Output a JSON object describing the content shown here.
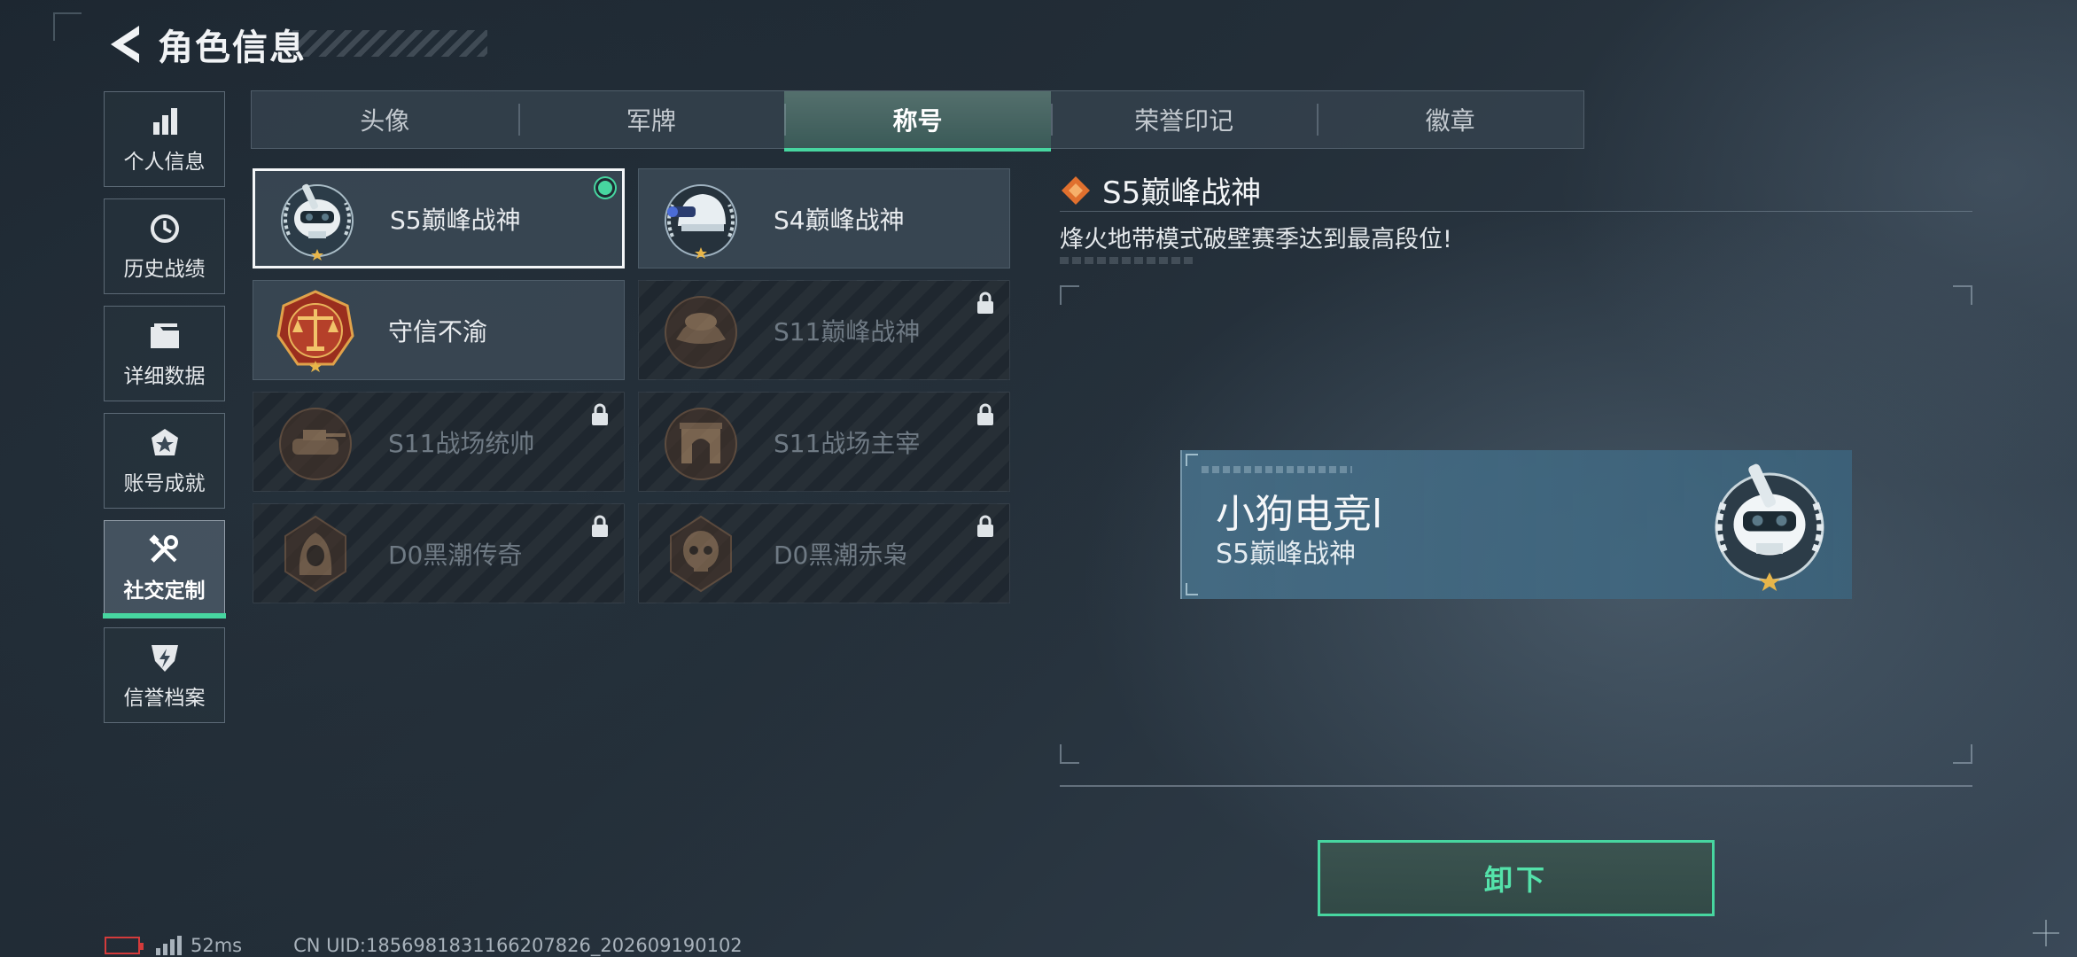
{
  "header": {
    "title": "角色信息"
  },
  "sidebar": {
    "items": [
      {
        "label": "个人信息",
        "icon": "bar-chart-icon"
      },
      {
        "label": "历史战绩",
        "icon": "clock-history-icon"
      },
      {
        "label": "详细数据",
        "icon": "folder-icon"
      },
      {
        "label": "账号成就",
        "icon": "achievement-icon"
      },
      {
        "label": "社交定制",
        "icon": "tools-icon",
        "active": true
      },
      {
        "label": "信誉档案",
        "icon": "credit-badge-icon"
      }
    ]
  },
  "tabs": [
    {
      "label": "头像"
    },
    {
      "label": "军牌"
    },
    {
      "label": "称号",
      "active": true
    },
    {
      "label": "荣誉印记"
    },
    {
      "label": "徽章"
    }
  ],
  "titles": [
    {
      "name": "S5巅峰战神",
      "emblem": "diver-skull-emblem",
      "selected": true,
      "equipped": true,
      "locked": false
    },
    {
      "name": "S4巅峰战神",
      "emblem": "helmet-emblem",
      "locked": false
    },
    {
      "name": "守信不渝",
      "emblem": "scales-emblem",
      "locked": false
    },
    {
      "name": "S11巅峰战神",
      "emblem": "bronze-hat-emblem",
      "locked": true
    },
    {
      "name": "S11战场统帅",
      "emblem": "bronze-tank-emblem",
      "locked": true
    },
    {
      "name": "S11战场主宰",
      "emblem": "bronze-arch-emblem",
      "locked": true
    },
    {
      "name": "D0黑潮传奇",
      "emblem": "bronze-hood-emblem",
      "locked": true
    },
    {
      "name": "D0黑潮赤枭",
      "emblem": "bronze-skull-emblem",
      "locked": true
    }
  ],
  "detail": {
    "title": "S5巅峰战神",
    "description": "烽火地带模式破壁赛季达到最高段位!"
  },
  "preview": {
    "player_name": "小狗电竞l",
    "title": "S5巅峰战神"
  },
  "action": {
    "label": "卸下"
  },
  "status": {
    "ping": "52ms",
    "uid": "CN UID:1856981831166207826_202609190102"
  },
  "colors": {
    "accent": "#47d6a0",
    "locked_text": "#6f7a84",
    "battery_low": "#d43b3b"
  }
}
